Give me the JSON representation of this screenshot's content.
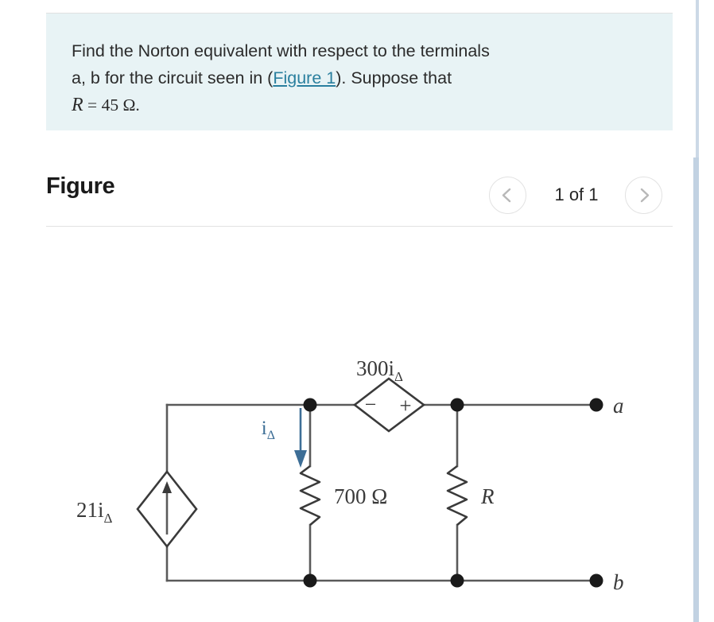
{
  "question": {
    "line1": "Find the Norton equivalent with respect to the terminals",
    "line2_before": "a, b for the circuit seen in (",
    "link_label": "Figure 1",
    "line2_after": "). Suppose that",
    "var_symbol": "R",
    "equals": " = ",
    "value": "45 Ω.",
    "background_color": "#e8f3f5",
    "link_color": "#2a7f9e"
  },
  "figure": {
    "title": "Figure",
    "page_count": "1 of 1",
    "prev_label": "chevron-left-icon",
    "next_label": "chevron-right-icon"
  },
  "circuit": {
    "dependent_current_source_label": "21i",
    "dependent_current_source_sub": "Δ",
    "dependent_voltage_source_label": "300i",
    "dependent_voltage_source_sub": "Δ",
    "voltage_source_minus": "−",
    "voltage_source_plus": "+",
    "current_label": "i",
    "current_label_sub": "Δ",
    "current_label_color": "#3d6e96",
    "resistor_1_label": "700 Ω",
    "resistor_2_label": "R",
    "terminal_a": "a",
    "terminal_b": "b",
    "wire_color": "#5a5a5a"
  }
}
